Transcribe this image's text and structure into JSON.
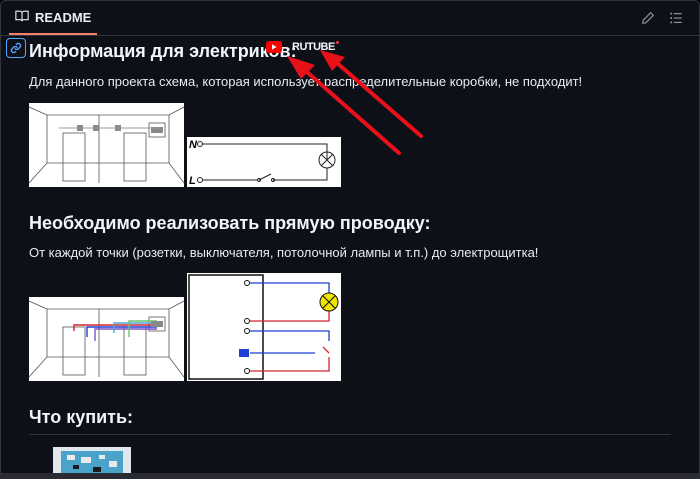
{
  "header": {
    "title": "README",
    "book_icon": "book-icon",
    "edit_icon": "pencil-icon",
    "outline_icon": "list-icon"
  },
  "sections": [
    {
      "heading": "Информация для электриков:",
      "youtube_icon": "youtube-icon",
      "rutube_label": "RUTUBE",
      "text": "Для данного проекта схема, которая использует распределительные коробки, не подходит!"
    },
    {
      "heading": "Необходимо реализовать прямую проводку:",
      "text": "От каждой точки (розетки, выключателя, потолочной лампы и т.п.) до электрощитка!"
    },
    {
      "heading": "Что купить:"
    }
  ],
  "diagram1": {
    "n_label": "N",
    "l_label": "L"
  },
  "colors": {
    "arrow": "#e8111a",
    "link": "#58a6ff",
    "youtube": "#ff0000",
    "wire_red": "#d0262f",
    "wire_blue": "#1f3fd6",
    "lamp": "#f2e500"
  }
}
